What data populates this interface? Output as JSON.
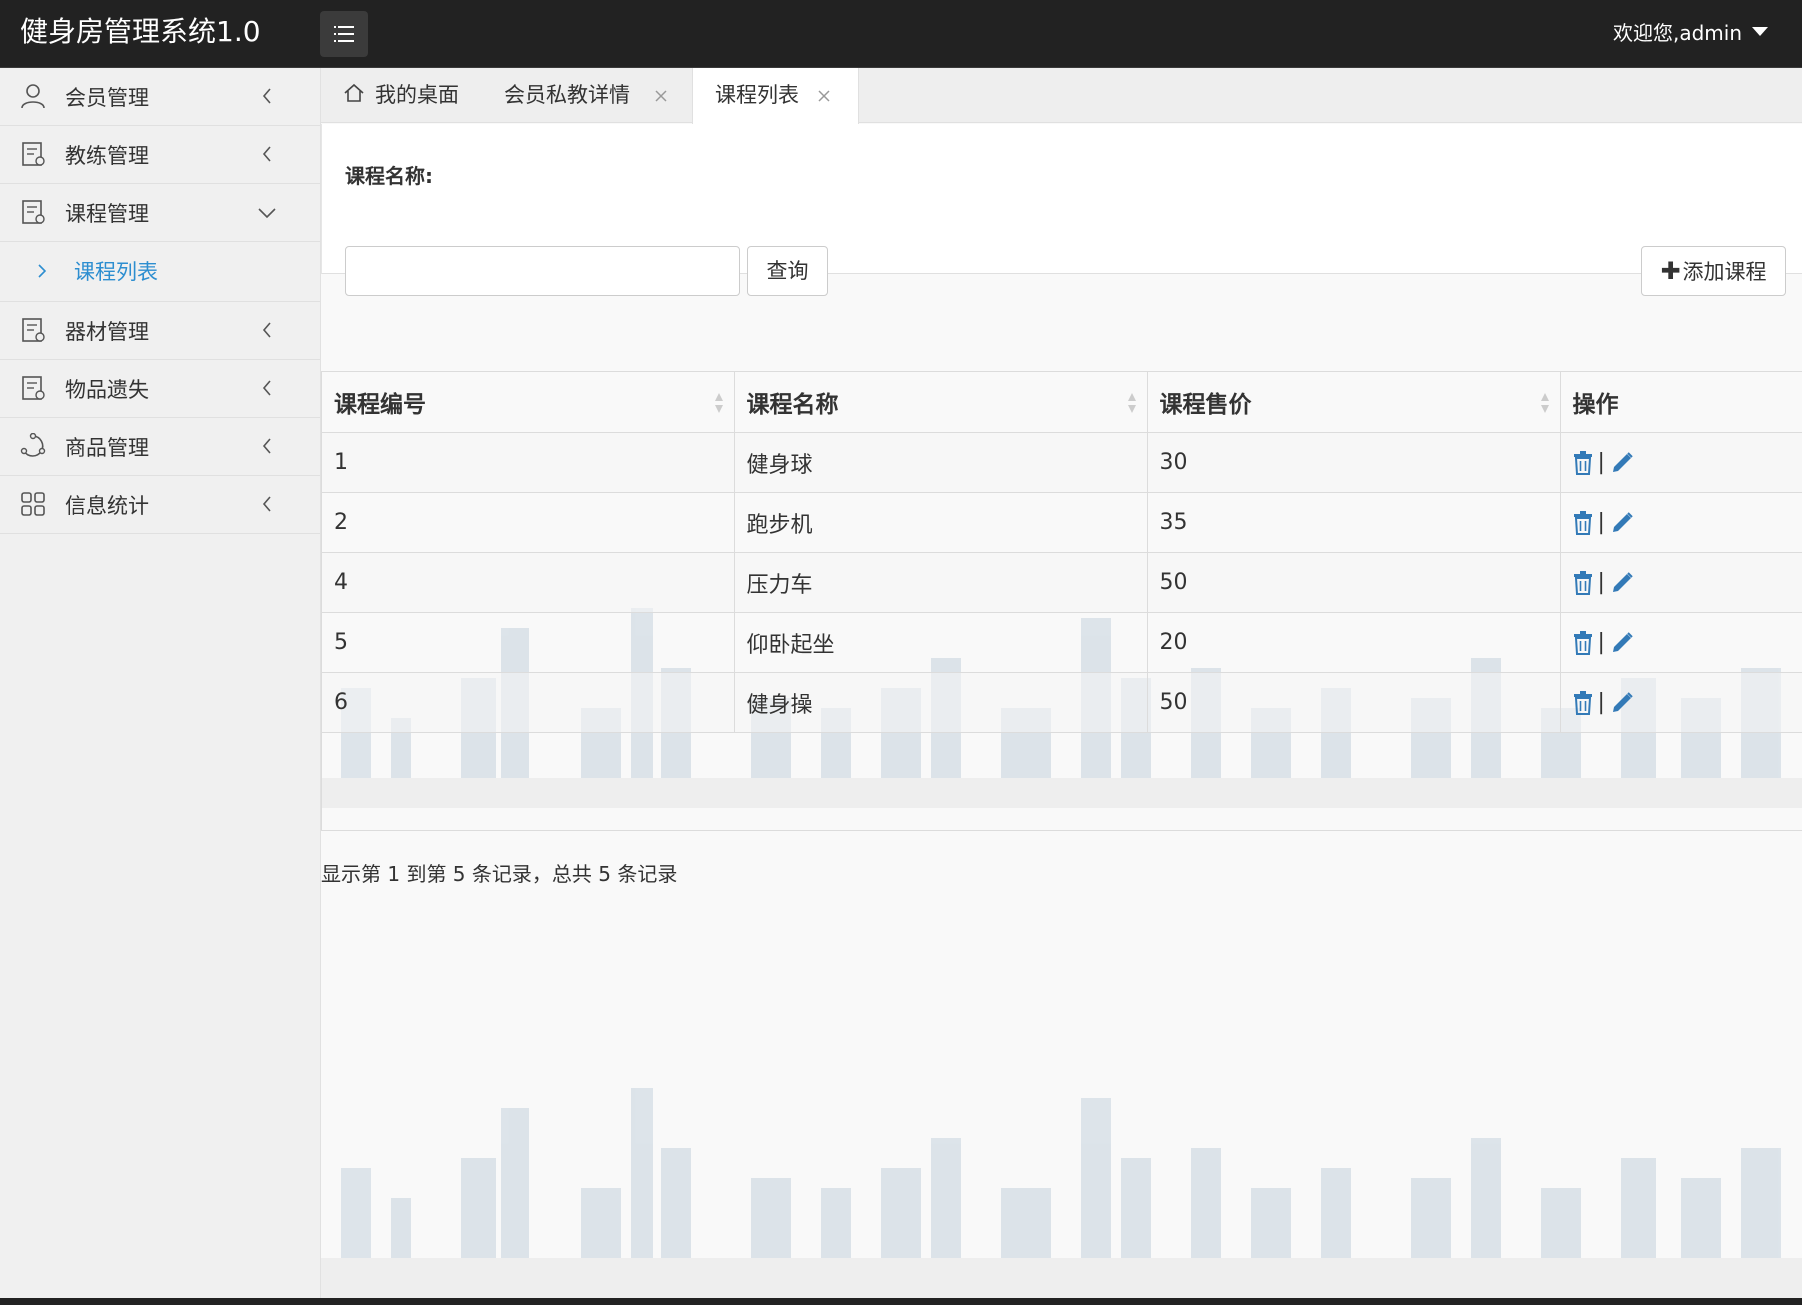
{
  "header": {
    "app_title": "健身房管理系统1.0",
    "user_greeting": "欢迎您,admin"
  },
  "sidebar": {
    "items": [
      {
        "label": "会员管理",
        "icon": "user-icon"
      },
      {
        "label": "教练管理",
        "icon": "document-icon"
      },
      {
        "label": "课程管理",
        "icon": "document-icon",
        "expanded": true
      },
      {
        "label": "器材管理",
        "icon": "document-icon"
      },
      {
        "label": "物品遗失",
        "icon": "document-icon"
      },
      {
        "label": "商品管理",
        "icon": "share-icon"
      },
      {
        "label": "信息统计",
        "icon": "grid-icon"
      }
    ],
    "sub_items": [
      {
        "label": "课程列表",
        "active": true
      }
    ]
  },
  "tabs": [
    {
      "label": "我的桌面",
      "icon": "home-icon"
    },
    {
      "label": "会员私教详情",
      "closable": true
    },
    {
      "label": "课程列表",
      "closable": true,
      "active": true
    }
  ],
  "search": {
    "label": "课程名称:",
    "value": "",
    "query_button": "查询",
    "add_button": "添加课程"
  },
  "table": {
    "columns": [
      "课程编号",
      "课程名称",
      "课程售价",
      "操作"
    ],
    "rows": [
      {
        "id": "1",
        "name": "健身球",
        "price": "30"
      },
      {
        "id": "2",
        "name": "跑步机",
        "price": "35"
      },
      {
        "id": "4",
        "name": "压力车",
        "price": "50"
      },
      {
        "id": "5",
        "name": "仰卧起坐",
        "price": "20"
      },
      {
        "id": "6",
        "name": "健身操",
        "price": "50"
      }
    ],
    "action_separator": "|"
  },
  "pagination": {
    "info": "显示第 1 到第 5 条记录，总共 5 条记录"
  },
  "colors": {
    "header_bg": "#222222",
    "sidebar_bg": "#f0f0f0",
    "active_link": "#2d8ed0",
    "action_icon": "#337ab7"
  }
}
